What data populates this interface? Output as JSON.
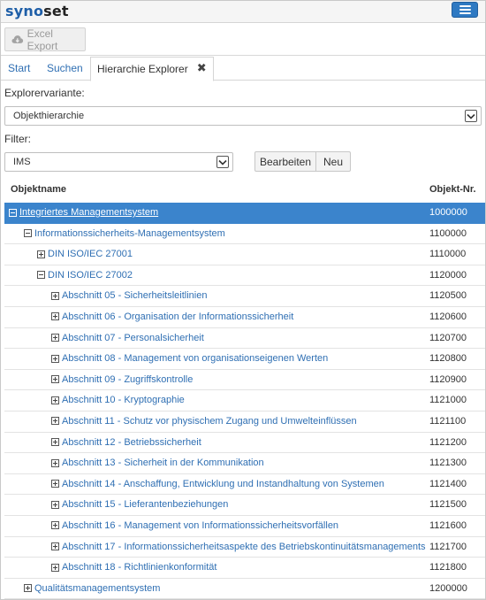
{
  "app": {
    "logo_part1": "syno",
    "logo_part2": "set"
  },
  "toolbar": {
    "excel_label": "Excel Export",
    "excel_icon": "cloud-download-icon"
  },
  "tabs": [
    {
      "label": "Start"
    },
    {
      "label": "Suchen"
    },
    {
      "label": "Hierarchie Explorer",
      "close": "✖"
    }
  ],
  "explorer": {
    "label": "Explorervariante:",
    "selected": "Objekthierarchie"
  },
  "filter": {
    "label": "Filter:",
    "selected": "IMS",
    "edit_label": "Bearbeiten",
    "new_label": "Neu"
  },
  "table": {
    "col_name": "Objektname",
    "col_num": "Objekt-Nr.",
    "rows": [
      {
        "name": "Integriertes Managementsystem",
        "num": "1000000",
        "level": 0,
        "toggle": "minus",
        "selected": true
      },
      {
        "name": "Informationssicherheits-Managementsystem",
        "num": "1100000",
        "level": 1,
        "toggle": "minus"
      },
      {
        "name": "DIN ISO/IEC 27001",
        "num": "1110000",
        "level": 2,
        "toggle": "plus"
      },
      {
        "name": "DIN ISO/IEC 27002",
        "num": "1120000",
        "level": 2,
        "toggle": "minus"
      },
      {
        "name": "Abschnitt 05 - Sicherheitsleitlinien",
        "num": "1120500",
        "level": 3,
        "toggle": "plus"
      },
      {
        "name": "Abschnitt 06 - Organisation der Informationssicherheit",
        "num": "1120600",
        "level": 3,
        "toggle": "plus"
      },
      {
        "name": "Abschnitt 07 - Personalsicherheit",
        "num": "1120700",
        "level": 3,
        "toggle": "plus"
      },
      {
        "name": "Abschnitt 08 - Management von organisationseigenen Werten",
        "num": "1120800",
        "level": 3,
        "toggle": "plus"
      },
      {
        "name": "Abschnitt 09 - Zugriffskontrolle",
        "num": "1120900",
        "level": 3,
        "toggle": "plus"
      },
      {
        "name": "Abschnitt 10 - Kryptographie",
        "num": "1121000",
        "level": 3,
        "toggle": "plus"
      },
      {
        "name": "Abschnitt 11 - Schutz vor physischem Zugang und Umwelteinflüssen",
        "num": "1121100",
        "level": 3,
        "toggle": "plus"
      },
      {
        "name": "Abschnitt 12 - Betriebssicherheit",
        "num": "1121200",
        "level": 3,
        "toggle": "plus"
      },
      {
        "name": "Abschnitt 13 - Sicherheit in der Kommunikation",
        "num": "1121300",
        "level": 3,
        "toggle": "plus"
      },
      {
        "name": "Abschnitt 14 - Anschaffung, Entwicklung und Instandhaltung von Systemen",
        "num": "1121400",
        "level": 3,
        "toggle": "plus"
      },
      {
        "name": "Abschnitt 15 - Lieferantenbeziehungen",
        "num": "1121500",
        "level": 3,
        "toggle": "plus"
      },
      {
        "name": "Abschnitt 16 - Management von Informationssicherheitsvorfällen",
        "num": "1121600",
        "level": 3,
        "toggle": "plus"
      },
      {
        "name": "Abschnitt 17 - Informationssicherheitsaspekte des Betriebskontinuitätsmanagements",
        "num": "1121700",
        "level": 3,
        "toggle": "plus"
      },
      {
        "name": "Abschnitt 18 - Richtlinienkonformität",
        "num": "1121800",
        "level": 3,
        "toggle": "plus"
      },
      {
        "name": "Qualitätsmanagementsystem",
        "num": "1200000",
        "level": 1,
        "toggle": "plus"
      }
    ]
  }
}
